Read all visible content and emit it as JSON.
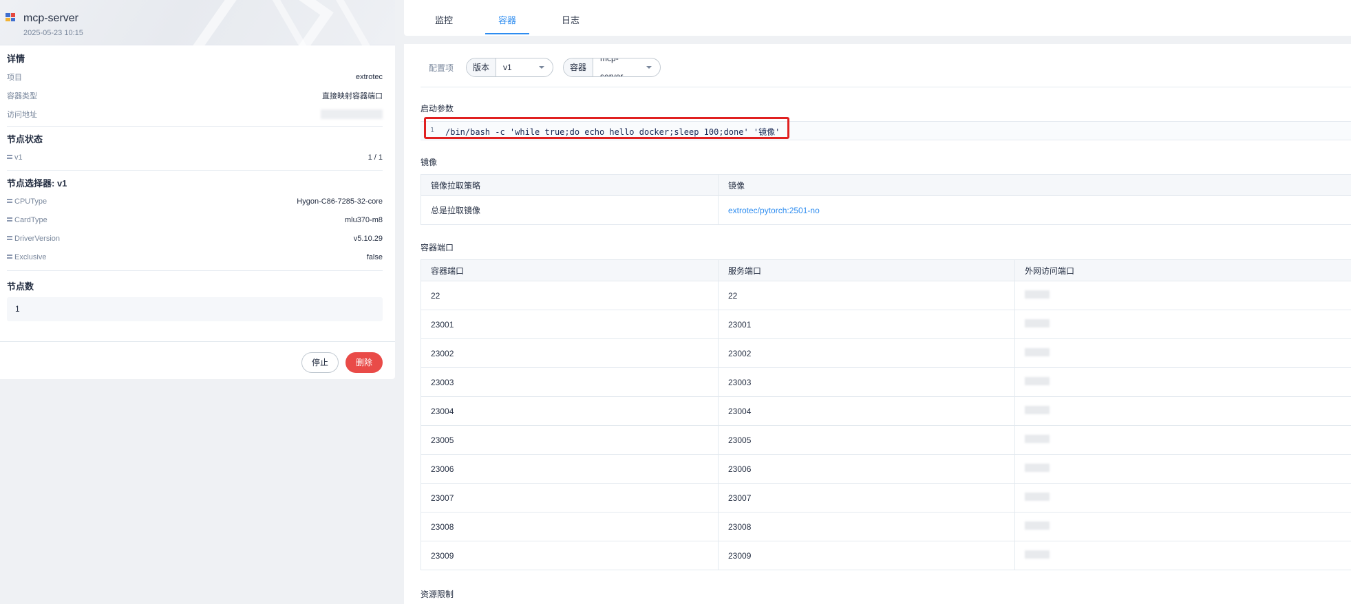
{
  "app": {
    "title": "mcp-server",
    "created": "2025-05-23 10:15",
    "icon_colors": [
      "#3f6fcf",
      "#e6483d",
      "#f2b233",
      "#3f6fcf"
    ]
  },
  "details": {
    "title": "详情",
    "rows": [
      {
        "key": "项目",
        "value": "extrotec"
      },
      {
        "key": "容器类型",
        "value": "直接映射容器端口"
      },
      {
        "key": "访问地址",
        "value": ""
      }
    ]
  },
  "node_status": {
    "title": "节点状态",
    "rows": [
      {
        "key": "v1",
        "value": "1 / 1"
      }
    ]
  },
  "node_selector": {
    "title": "节点选择器: v1",
    "rows": [
      {
        "key": "CPUType",
        "value": "Hygon-C86-7285-32-core"
      },
      {
        "key": "CardType",
        "value": "mlu370-m8"
      },
      {
        "key": "DriverVersion",
        "value": "v5.10.29"
      },
      {
        "key": "Exclusive",
        "value": "false"
      }
    ]
  },
  "node_count": {
    "title": "节点数",
    "value": "1"
  },
  "actions": {
    "stop": "停止",
    "delete": "删除"
  },
  "tabs": {
    "monitor": "监控",
    "container": "容器",
    "logs": "日志"
  },
  "config": {
    "label": "配置项",
    "version_label": "版本",
    "version_value": "v1",
    "container_label": "容器",
    "container_value": "mcp-server"
  },
  "startup": {
    "label": "启动参数",
    "line_no": "1",
    "command": "/bin/bash -c 'while true;do echo hello docker;sleep 100;done' '镜像'"
  },
  "image": {
    "label": "镜像",
    "headers": [
      "镜像拉取策略",
      "镜像"
    ],
    "policy": "总是拉取镜像",
    "image": "extrotec/pytorch:2501-no"
  },
  "ports": {
    "label": "容器端口",
    "headers": [
      "容器端口",
      "服务端口",
      "外网访问端口"
    ],
    "rows": [
      {
        "container": "22",
        "service": "22"
      },
      {
        "container": "23001",
        "service": "23001"
      },
      {
        "container": "23002",
        "service": "23002"
      },
      {
        "container": "23003",
        "service": "23003"
      },
      {
        "container": "23004",
        "service": "23004"
      },
      {
        "container": "23005",
        "service": "23005"
      },
      {
        "container": "23006",
        "service": "23006"
      },
      {
        "container": "23007",
        "service": "23007"
      },
      {
        "container": "23008",
        "service": "23008"
      },
      {
        "container": "23009",
        "service": "23009"
      }
    ]
  },
  "resources": {
    "label": "资源限制"
  }
}
